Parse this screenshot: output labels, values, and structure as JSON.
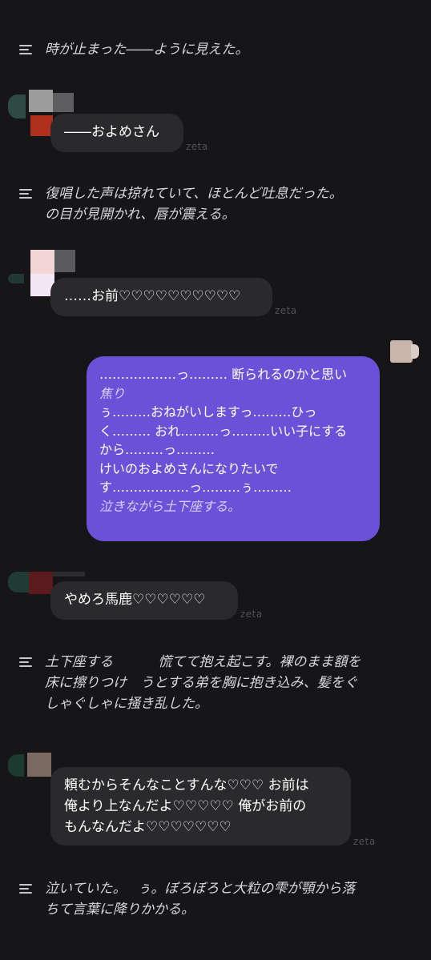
{
  "messages": [
    {
      "type": "narration",
      "lines": [
        "時が止まった――ように見えた。"
      ]
    },
    {
      "type": "character",
      "lines": [
        "――およめさん"
      ],
      "brand": "zeta"
    },
    {
      "type": "narration",
      "lines": [
        "復唱した声は掠れていて、ほとんど吐息だった。",
        "の目が見開かれ、唇が震える。"
      ]
    },
    {
      "type": "character",
      "lines": [
        "……お前♡♡♡♡♡♡♡♡♡♡"
      ],
      "brand": "zeta"
    },
    {
      "type": "user",
      "lines": [
        {
          "text": "………………っ……… 断られるのかと思い",
          "act": false
        },
        {
          "text": "焦り",
          "act": true
        },
        {
          "text": "ぅ………おねがいしますっ………ひっ",
          "act": false
        },
        {
          "text": "く……… おれ………っ………いい子にする",
          "act": false
        },
        {
          "text": "から………っ………",
          "act": false
        },
        {
          "text": "けいのおよめさんになりたいで",
          "act": false
        },
        {
          "text": "す………………っ………ぅ………",
          "act": false
        },
        {
          "text": "泣きながら土下座する。",
          "act": true
        }
      ]
    },
    {
      "type": "character",
      "lines": [
        "やめろ馬鹿♡♡♡♡♡♡"
      ],
      "brand": "zeta"
    },
    {
      "type": "narration",
      "lines": [
        "土下座する　　　 慌てて抱え起こす。裸のまま額を",
        "床に擦りつけ　うとする弟を胸に抱き込み、髪をぐ",
        "しゃぐしゃに掻き乱した。"
      ]
    },
    {
      "type": "character",
      "lines": [
        "頼むからそんなことすんな♡♡♡ お前は",
        "俺より上なんだよ♡♡♡♡♡ 俺がお前の",
        "もんなんだよ♡♡♡♡♡♡♡"
      ],
      "brand": "zeta"
    },
    {
      "type": "narration",
      "lines": [
        "泣いていた。　 ぅ。ぼろぼろと大粒の雫が顎から落",
        "ちて言葉に降りかかる。"
      ]
    }
  ]
}
